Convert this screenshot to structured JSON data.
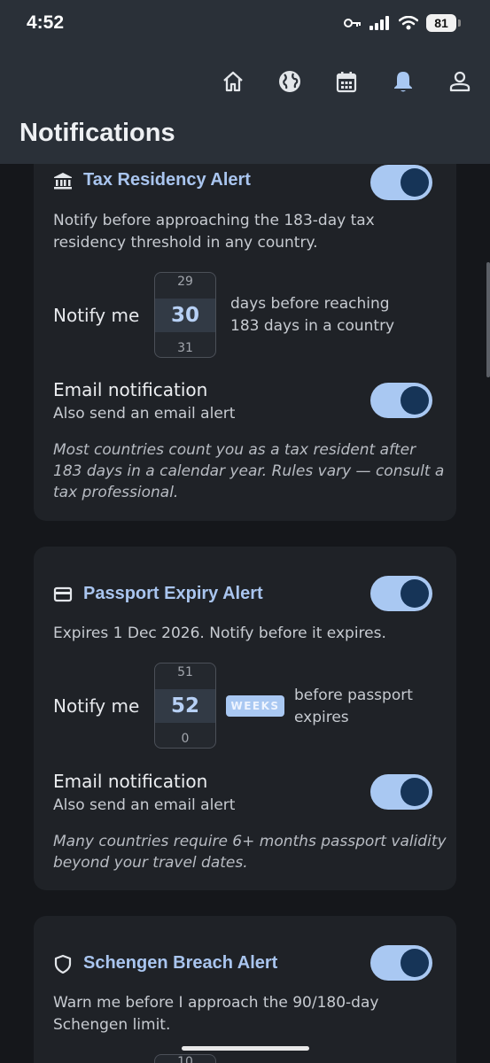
{
  "status_bar": {
    "time": "4:52",
    "battery": "81"
  },
  "header": {
    "title": "Notifications",
    "nav_icons": [
      "home-icon",
      "globe-icon",
      "calendar-icon",
      "bell-icon",
      "person-icon"
    ]
  },
  "cards": {
    "tax": {
      "icon": "bank-icon",
      "title": "Tax Residency Alert",
      "enabled": true,
      "description": "Notify before approaching the 183-day tax residency threshold in any country.",
      "notify_label": "Notify me",
      "picker": {
        "prev": "29",
        "current": "30",
        "next": "31"
      },
      "after_text": "days before reaching 183 days in a country",
      "email_title": "Email notification",
      "email_sub": "Also send an email alert",
      "email_enabled": true,
      "note": "Most countries count you as a tax resident after 183 days in a calendar year. Rules vary — consult a tax professional."
    },
    "passport": {
      "icon": "credit-card-icon",
      "title": "Passport Expiry Alert",
      "enabled": true,
      "description": "Expires 1 Dec 2026. Notify before it expires.",
      "notify_label": "Notify me",
      "picker": {
        "prev": "51",
        "current": "52",
        "next": "0"
      },
      "unit_badge": "WEEKS",
      "after_text": "before passport expires",
      "email_title": "Email notification",
      "email_sub": "Also send an email alert",
      "email_enabled": true,
      "note": "Many countries require 6+ months passport validity beyond your travel dates."
    },
    "schengen": {
      "icon": "shield-icon",
      "title": "Schengen Breach Alert",
      "enabled": true,
      "description": "Warn me before I approach the 90/180-day Schengen limit.",
      "picker_prev": "10"
    }
  }
}
